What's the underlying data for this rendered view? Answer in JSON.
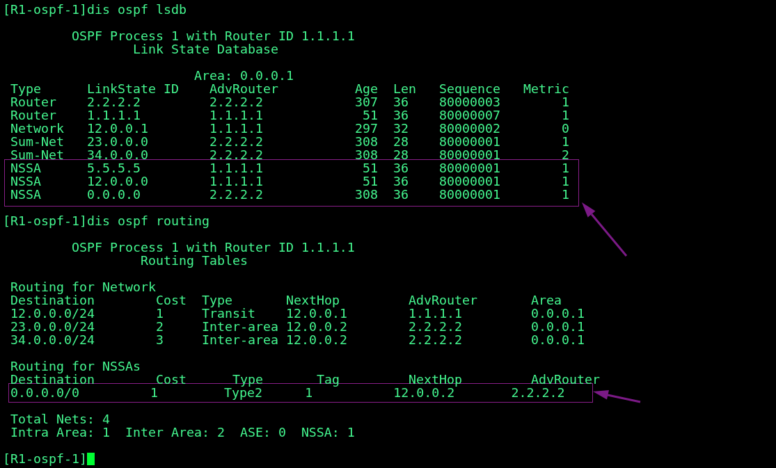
{
  "terminal": {
    "lines": [
      {
        "kind": "prompt",
        "text": "[R1-ospf-1]dis ospf lsdb"
      },
      {
        "kind": "blank"
      },
      {
        "kind": "text",
        "text": "         OSPF Process 1 with Router ID 1.1.1.1"
      },
      {
        "kind": "text",
        "text": "                 Link State Database"
      },
      {
        "kind": "blank"
      },
      {
        "kind": "text",
        "text": "                         Area: 0.0.0.1"
      },
      {
        "kind": "table",
        "columns": [
          "Type",
          "LinkState ID",
          "AdvRouter",
          "Age",
          "Len",
          "Sequence",
          "Metric"
        ],
        "rows": [
          {
            "cells": [
              "Router",
              "2.2.2.2",
              "2.2.2.2",
              "307",
              "36",
              "80000003",
              "1"
            ],
            "highlighted": false
          },
          {
            "cells": [
              "Router",
              "1.1.1.1",
              "1.1.1.1",
              "51",
              "36",
              "80000007",
              "1"
            ],
            "highlighted": false
          },
          {
            "cells": [
              "Network",
              "12.0.0.1",
              "1.1.1.1",
              "297",
              "32",
              "80000002",
              "0"
            ],
            "highlighted": false
          },
          {
            "cells": [
              "Sum-Net",
              "23.0.0.0",
              "2.2.2.2",
              "308",
              "28",
              "80000001",
              "1"
            ],
            "highlighted": false
          },
          {
            "cells": [
              "Sum-Net",
              "34.0.0.0",
              "2.2.2.2",
              "308",
              "28",
              "80000001",
              "2"
            ],
            "highlighted": false
          },
          {
            "cells": [
              "NSSA",
              "5.5.5.5",
              "1.1.1.1",
              "51",
              "36",
              "80000001",
              "1"
            ],
            "highlighted": true
          },
          {
            "cells": [
              "NSSA",
              "12.0.0.0",
              "1.1.1.1",
              "51",
              "36",
              "80000001",
              "1"
            ],
            "highlighted": true
          },
          {
            "cells": [
              "NSSA",
              "0.0.0.0",
              "2.2.2.2",
              "308",
              "36",
              "80000001",
              "1"
            ],
            "highlighted": true
          }
        ]
      },
      {
        "kind": "blank"
      },
      {
        "kind": "prompt",
        "text": "[R1-ospf-1]dis ospf routing"
      },
      {
        "kind": "blank"
      },
      {
        "kind": "text",
        "text": "         OSPF Process 1 with Router ID 1.1.1.1"
      },
      {
        "kind": "text",
        "text": "                  Routing Tables"
      },
      {
        "kind": "blank"
      },
      {
        "kind": "text",
        "text": " Routing for Network"
      },
      {
        "kind": "table",
        "columns": [
          "Destination",
          "Cost",
          "Type",
          "NextHop",
          "AdvRouter",
          "Area"
        ],
        "rows": [
          {
            "cells": [
              "12.0.0.0/24",
              "1",
              "Transit",
              "12.0.0.1",
              "1.1.1.1",
              "0.0.0.1"
            ],
            "highlighted": false
          },
          {
            "cells": [
              "23.0.0.0/24",
              "2",
              "Inter-area",
              "12.0.0.2",
              "2.2.2.2",
              "0.0.0.1"
            ],
            "highlighted": false
          },
          {
            "cells": [
              "34.0.0.0/24",
              "3",
              "Inter-area",
              "12.0.0.2",
              "2.2.2.2",
              "0.0.0.1"
            ],
            "highlighted": false
          }
        ]
      },
      {
        "kind": "blank"
      },
      {
        "kind": "text",
        "text": " Routing for NSSAs"
      },
      {
        "kind": "table",
        "columns": [
          "Destination",
          "Cost",
          "Type",
          "Tag",
          "NextHop",
          "AdvRouter"
        ],
        "rows": [
          {
            "cells": [
              "0.0.0.0/0",
              "1",
              "Type2",
              "1",
              "12.0.0.2",
              "2.2.2.2"
            ],
            "highlighted": true
          }
        ]
      },
      {
        "kind": "blank"
      },
      {
        "kind": "text",
        "text": " Total Nets: 4"
      },
      {
        "kind": "text",
        "text": " Intra Area: 1  Inter Area: 2  ASE: 0  NSSA: 1"
      },
      {
        "kind": "blank"
      },
      {
        "kind": "prompt",
        "text": "[R1-ospf-1]",
        "cursor": true
      }
    ]
  }
}
